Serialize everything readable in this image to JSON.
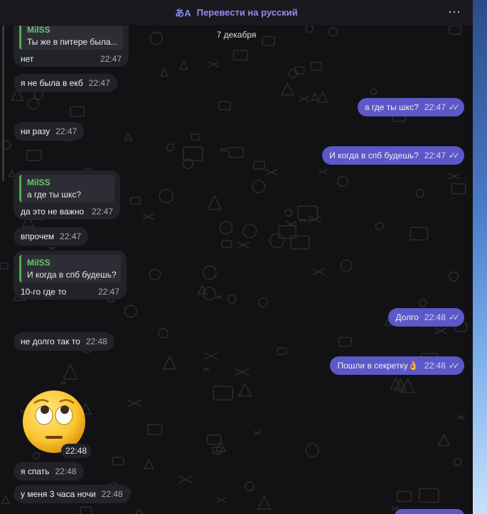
{
  "topbar": {
    "translate_label": "Перевести на русский",
    "menu_icon": "⋯"
  },
  "date_label": "7 декабря",
  "messages": [
    {
      "type": "in-reply",
      "author": "MilSS",
      "quote": "Ты же в питере была...",
      "text": "нет",
      "time": "22:47"
    },
    {
      "type": "in",
      "text": "я не была в екб",
      "time": "22:47"
    },
    {
      "type": "out",
      "text": "а где ты шкс?",
      "time": "22:47"
    },
    {
      "type": "in",
      "text": "ни разу",
      "time": "22:47"
    },
    {
      "type": "out",
      "text": "И когда в спб будешь?",
      "time": "22:47"
    },
    {
      "type": "in-reply",
      "author": "MilSS",
      "quote": "а где ты шкс?",
      "text": "да это не важно",
      "time": "22:47"
    },
    {
      "type": "in",
      "text": "впрочем",
      "time": "22:47"
    },
    {
      "type": "in-reply",
      "author": "MilSS",
      "quote": "И когда в спб будешь?",
      "text": "10-го где то",
      "time": "22:47"
    },
    {
      "type": "out",
      "text": "Долго",
      "time": "22:48"
    },
    {
      "type": "in",
      "text": "не долго так то",
      "time": "22:48"
    },
    {
      "type": "out",
      "text": "Пошли в секретку👌",
      "time": "22:48"
    },
    {
      "type": "in-sticker",
      "emoji": "rolling-eyes-face",
      "time": "22:48"
    },
    {
      "type": "in",
      "text": "я спать",
      "time": "22:48"
    },
    {
      "type": "in",
      "text": "у меня 3 часа ночи",
      "time": "22:48"
    }
  ],
  "colors": {
    "incoming": "#222229",
    "outgoing": "#5b58c8",
    "author": "#6bc66a",
    "accent": "#8f8cf0"
  }
}
